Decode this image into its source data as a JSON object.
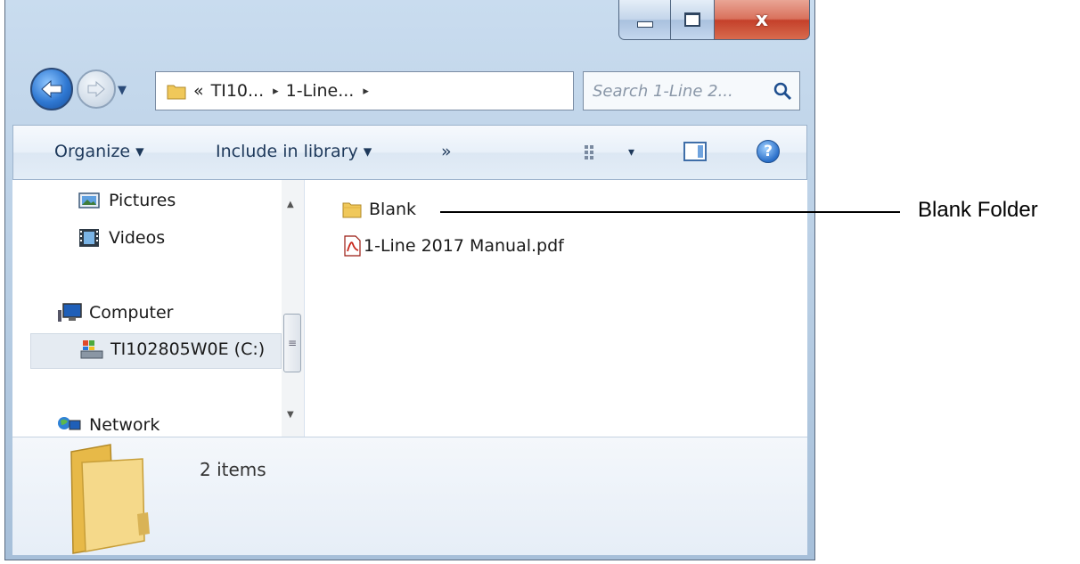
{
  "window": {
    "caption_buttons": {
      "minimize": "minimize-icon",
      "maximize": "maximize-icon",
      "close_label": "x"
    },
    "navigation": {
      "back": "back-arrow-icon",
      "forward": "forward-arrow-icon",
      "recent": "chevron-down-icon"
    },
    "address_bar": {
      "overflow": "«",
      "crumbs": [
        "TI10...",
        "1-Line..."
      ],
      "separator": "▸",
      "dropdown": "▾",
      "refresh": "refresh-icon"
    },
    "search": {
      "placeholder": "Search 1-Line 2...",
      "icon": "search-icon"
    },
    "command_bar": {
      "organize": "Organize ▾",
      "include": "Include in library ▾",
      "more": "»",
      "view_dropdown": "▾",
      "help": "?"
    },
    "nav_pane": {
      "items": [
        {
          "label": "Pictures",
          "icon": "pictures-icon"
        },
        {
          "label": "Videos",
          "icon": "videos-icon"
        },
        {
          "label": "Computer",
          "icon": "computer-icon"
        },
        {
          "label": "TI102805W0E (C:)",
          "icon": "drive-icon"
        },
        {
          "label": "Network",
          "icon": "network-icon"
        }
      ],
      "scroll": {
        "up": "▲",
        "down": "▼",
        "grip": "≡"
      }
    },
    "files": [
      {
        "name": "Blank",
        "icon": "folder-icon"
      },
      {
        "name": "1-Line 2017 Manual.pdf",
        "icon": "pdf-icon"
      }
    ],
    "details": {
      "count": "2 items",
      "icon": "large-folder-icon"
    }
  },
  "annotation": {
    "label": "Blank Folder"
  },
  "colors": {
    "accent": "#2f78d2",
    "close": "#c4402a",
    "folder": "#f0c85a"
  }
}
